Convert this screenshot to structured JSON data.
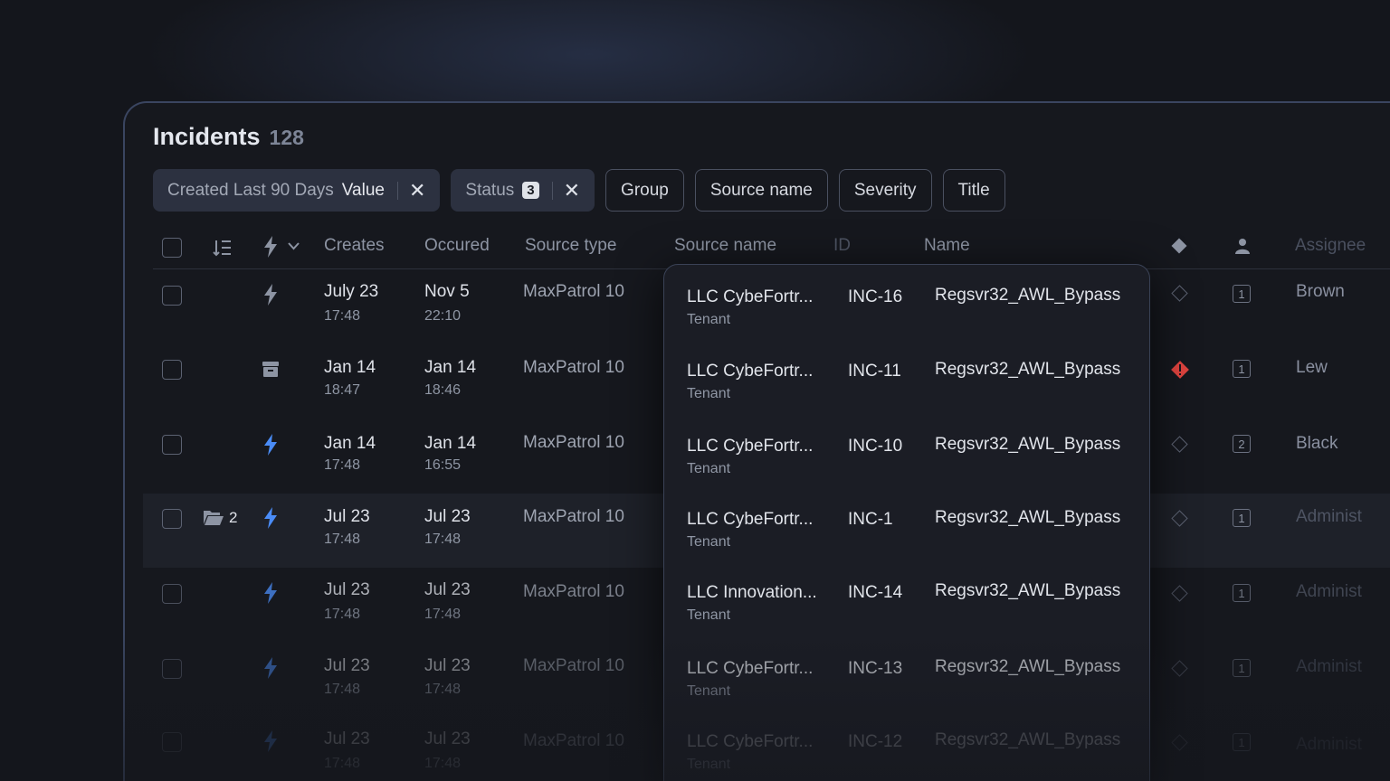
{
  "page": {
    "title": "Incidents",
    "count": "128"
  },
  "filters": [
    {
      "label": "Created Last 90 Days",
      "value": "Value",
      "removable": true
    },
    {
      "label": "Status",
      "badge": "3",
      "removable": true
    },
    {
      "label": "Group"
    },
    {
      "label": "Source name"
    },
    {
      "label": "Severity"
    },
    {
      "label": "Title"
    }
  ],
  "columns": {
    "creates": "Creates",
    "occured": "Occured",
    "source_type": "Source type",
    "source_name": "Source name",
    "id": "ID",
    "name": "Name",
    "assignee": "Assignee"
  },
  "rows": [
    {
      "type_icon": "bolt-icon",
      "created_date": "July 23",
      "created_time": "17:48",
      "occured_date": "Nov 5",
      "occured_time": "22:10",
      "source_type": "MaxPatrol 10",
      "severity_icon": "diamond-outline-icon",
      "count": "1",
      "assignee": "Brown"
    },
    {
      "type_icon": "archive-icon",
      "created_date": "Jan 14",
      "created_time": "18:47",
      "occured_date": "Jan 14",
      "occured_time": "18:46",
      "source_type": "MaxPatrol 10",
      "severity_icon": "diamond-alert-icon",
      "count": "1",
      "assignee": "Lew"
    },
    {
      "type_icon": "bolt-icon",
      "created_date": "Jan 14",
      "created_time": "17:48",
      "occured_date": "Jan 14",
      "occured_time": "16:55",
      "source_type": "MaxPatrol 10",
      "severity_icon": "diamond-outline-icon",
      "count": "2",
      "assignee": "Black"
    },
    {
      "group_count": "2",
      "type_icon": "bolt-icon",
      "created_date": "Jul 23",
      "created_time": "17:48",
      "occured_date": "Jul 23",
      "occured_time": "17:48",
      "source_type": "MaxPatrol 10",
      "severity_icon": "diamond-outline-icon",
      "count": "1",
      "assignee": "Administ"
    },
    {
      "type_icon": "bolt-icon",
      "created_date": "Jul 23",
      "created_time": "17:48",
      "occured_date": "Jul 23",
      "occured_time": "17:48",
      "source_type": "MaxPatrol 10",
      "severity_icon": "diamond-outline-icon",
      "count": "1",
      "assignee": "Administ"
    },
    {
      "type_icon": "bolt-icon",
      "created_date": "Jul 23",
      "created_time": "17:48",
      "occured_date": "Jul 23",
      "occured_time": "17:48",
      "source_type": "MaxPatrol 10",
      "severity_icon": "diamond-outline-icon",
      "count": "1",
      "assignee": "Administ"
    },
    {
      "type_icon": "bolt-icon",
      "created_date": "Jul 23",
      "created_time": "17:48",
      "occured_date": "Jul 23",
      "occured_time": "17:48",
      "source_type": "MaxPatrol 10",
      "severity_icon": "diamond-outline-icon",
      "count": "1",
      "assignee": "Administ"
    }
  ],
  "popup_rows": [
    {
      "source_name": "LLC CybeFortr...",
      "tenant": "Tenant",
      "id": "INC-16",
      "name": "Regsvr32_AWL_Bypass"
    },
    {
      "source_name": "LLC CybeFortr...",
      "tenant": "Tenant",
      "id": "INC-11",
      "name": "Regsvr32_AWL_Bypass"
    },
    {
      "source_name": "LLC CybeFortr...",
      "tenant": "Tenant",
      "id": "INC-10",
      "name": "Regsvr32_AWL_Bypass"
    },
    {
      "source_name": "LLC CybeFortr...",
      "tenant": "Tenant",
      "id": "INC-1",
      "name": "Regsvr32_AWL_Bypass"
    },
    {
      "source_name": "LLC Innovation...",
      "tenant": "Tenant",
      "id": "INC-14",
      "name": "Regsvr32_AWL_Bypass"
    },
    {
      "source_name": "LLC CybeFortr...",
      "tenant": "Tenant",
      "id": "INC-13",
      "name": "Regsvr32_AWL_Bypass"
    },
    {
      "source_name": "LLC CybeFortr...",
      "tenant": "Tenant",
      "id": "INC-12",
      "name": "Regsvr32_AWL_Bypass"
    }
  ],
  "colors": {
    "accent_blue": "#4a8cf7",
    "alert_red": "#e0443f",
    "background": "#14161c"
  }
}
